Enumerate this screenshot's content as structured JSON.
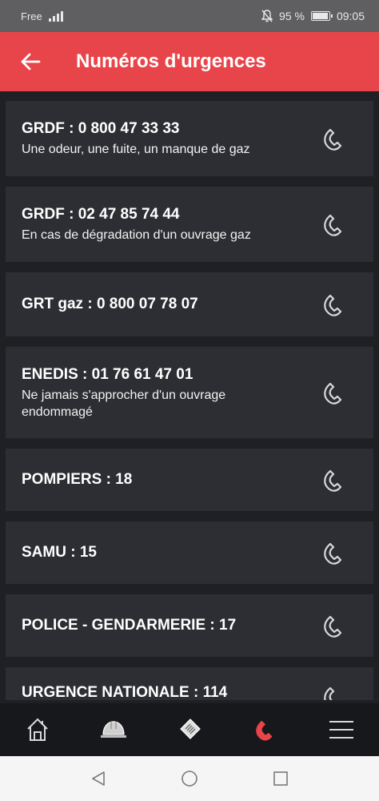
{
  "status_bar": {
    "carrier": "Free",
    "battery_percent": "95 %",
    "time": "09:05",
    "battery_level": 0.95
  },
  "header": {
    "title": "Numéros d'urgences",
    "back_icon": "arrow-left-icon",
    "background_color": "#e8454a"
  },
  "contacts": [
    {
      "title": "GRDF : 0 800 47 33 33",
      "subtitle": "Une odeur, une fuite, un manque de gaz"
    },
    {
      "title": "GRDF : 02 47 85 74 44",
      "subtitle": "En cas de dégradation d'un ouvrage gaz"
    },
    {
      "title": "GRT gaz : 0 800 07 78 07",
      "subtitle": ""
    },
    {
      "title": "ENEDIS : 01 76 61 47 01",
      "subtitle": "Ne jamais s'approcher  d'un ouvrage endommagé"
    },
    {
      "title": "POMPIERS : 18",
      "subtitle": ""
    },
    {
      "title": "SAMU : 15",
      "subtitle": ""
    },
    {
      "title": "POLICE - GENDARMERIE : 17",
      "subtitle": ""
    },
    {
      "title": "URGENCE NATIONALE : 114",
      "subtitle": ""
    }
  ],
  "bottom_nav": {
    "items": [
      {
        "icon": "home-icon",
        "active": false
      },
      {
        "icon": "helmet-icon",
        "active": false
      },
      {
        "icon": "document-icon",
        "active": false
      },
      {
        "icon": "phone-icon",
        "active": true
      },
      {
        "icon": "menu-icon",
        "active": false
      }
    ],
    "active_color": "#e8454a",
    "icon_color": "#d8d8d8"
  },
  "system_nav": {
    "items": [
      "back-triangle-icon",
      "home-circle-icon",
      "recents-square-icon"
    ]
  }
}
